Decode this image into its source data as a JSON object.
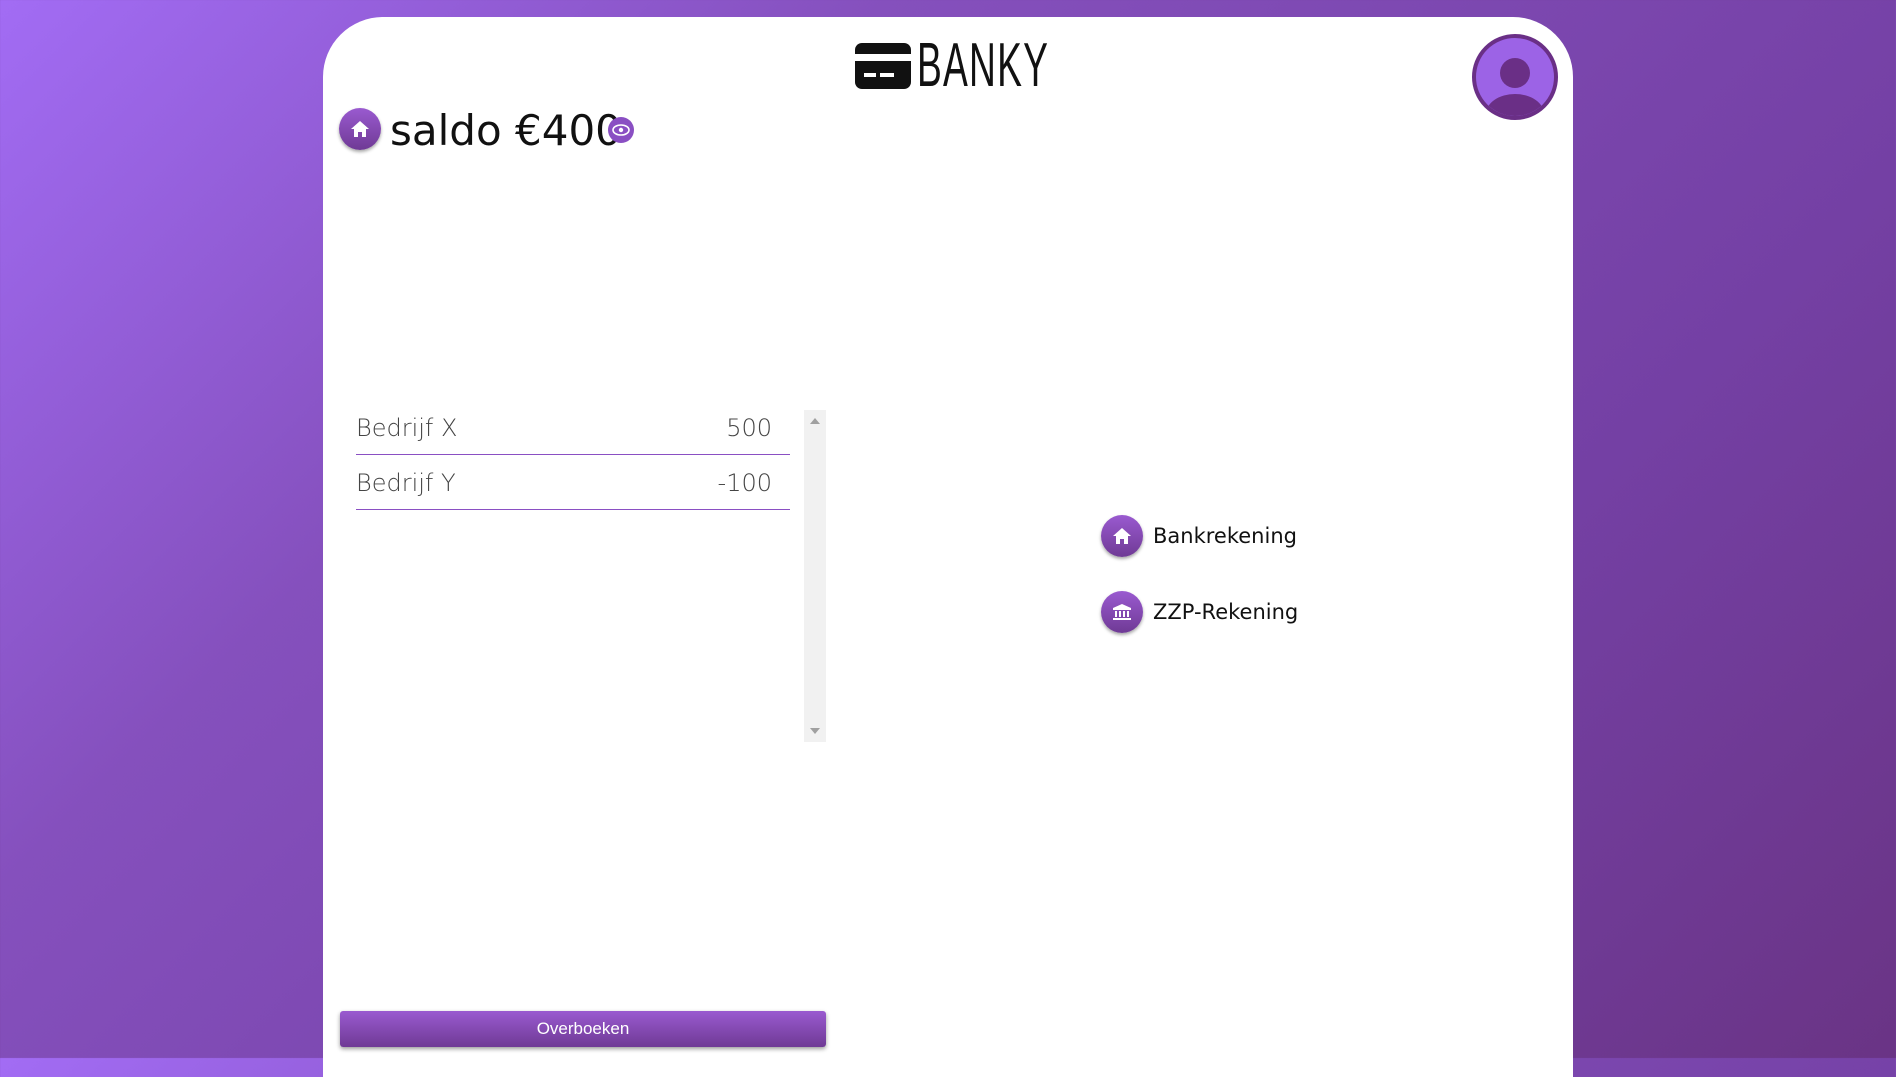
{
  "app": {
    "name": "BANKY"
  },
  "header": {
    "balance_text": "saldo €400"
  },
  "transactions": [
    {
      "name": "Bedrijf X",
      "amount": "500"
    },
    {
      "name": "Bedrijf Y",
      "amount": "-100"
    }
  ],
  "accounts": [
    {
      "label": "Bankrekening",
      "icon": "home-icon"
    },
    {
      "label": "ZZP-Rekening",
      "icon": "bank-icon"
    }
  ],
  "actions": {
    "transfer_label": "Overboeken"
  },
  "colors": {
    "accent": "#8a4fc3",
    "accent_dark": "#6a2f86",
    "background_start": "#a26cf4",
    "background_end": "#6a3485"
  }
}
